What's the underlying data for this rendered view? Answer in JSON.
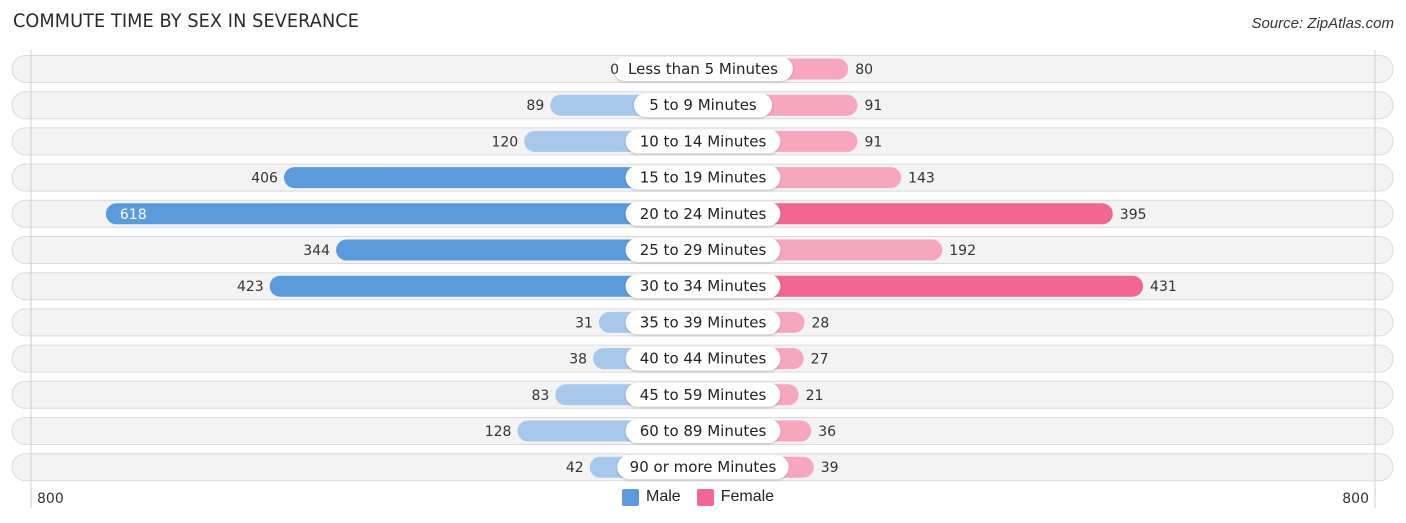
{
  "header": {
    "title": "COMMUTE TIME BY SEX IN SEVERANCE",
    "source": "Source: ZipAtlas.com"
  },
  "colors": {
    "male_strong": "#5b9bdc",
    "male_light": "#a7c7eb",
    "female_strong": "#f06892",
    "female_light": "#f7a6c0",
    "row_bg": "#f3f3f3"
  },
  "chart_data": {
    "type": "bar",
    "orientation": "horizontal-diverging",
    "title": "COMMUTE TIME BY SEX IN SEVERANCE",
    "categories": [
      "Less than 5 Minutes",
      "5 to 9 Minutes",
      "10 to 14 Minutes",
      "15 to 19 Minutes",
      "20 to 24 Minutes",
      "25 to 29 Minutes",
      "30 to 34 Minutes",
      "35 to 39 Minutes",
      "40 to 44 Minutes",
      "45 to 59 Minutes",
      "60 to 89 Minutes",
      "90 or more Minutes"
    ],
    "series": [
      {
        "name": "Male",
        "side": "left",
        "values": [
          0,
          89,
          120,
          406,
          618,
          344,
          423,
          31,
          38,
          83,
          128,
          42
        ]
      },
      {
        "name": "Female",
        "side": "right",
        "values": [
          80,
          91,
          91,
          143,
          395,
          192,
          431,
          28,
          27,
          21,
          36,
          39
        ]
      }
    ],
    "axis": {
      "left_label": "800",
      "right_label": "800",
      "max": 800
    },
    "legend": {
      "position": "bottom-center",
      "entries": [
        "Male",
        "Female"
      ]
    },
    "grid": false
  }
}
